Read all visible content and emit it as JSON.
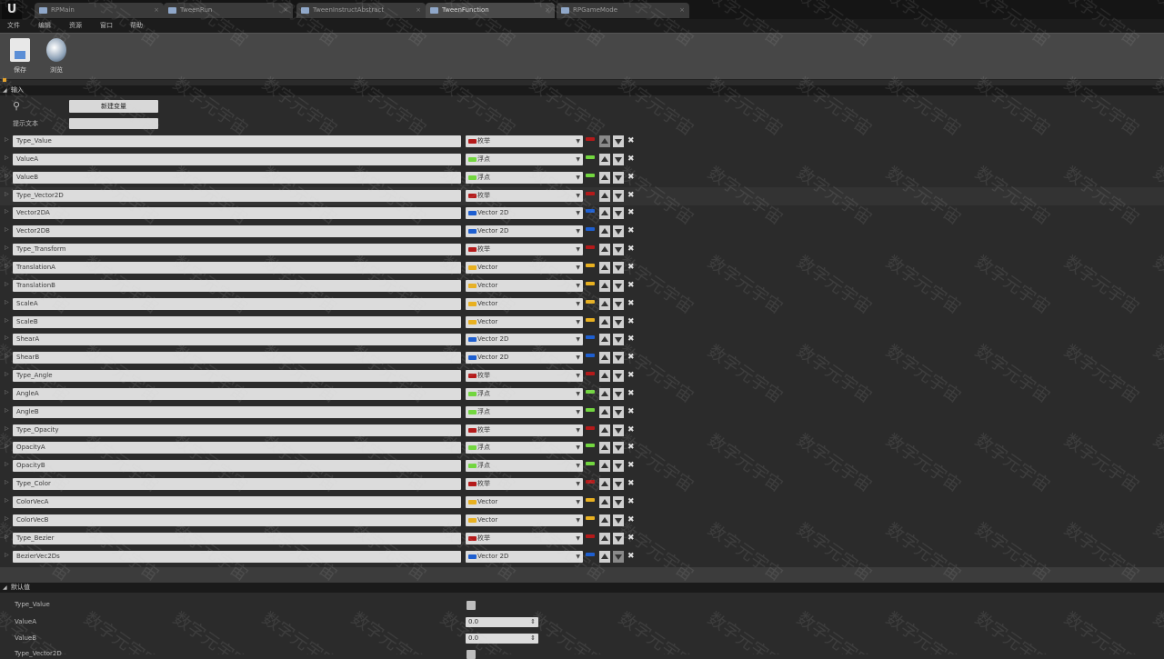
{
  "tabs": [
    {
      "label": "RPMain",
      "active": false
    },
    {
      "label": "TweenRun",
      "active": false
    },
    {
      "label": "TweenInstructAbstract",
      "active": false
    },
    {
      "label": "TweenFunction",
      "active": true
    },
    {
      "label": "RPGameMode",
      "active": false
    }
  ],
  "menu": [
    "文件",
    "编辑",
    "资源",
    "窗口",
    "帮助"
  ],
  "toolbar": {
    "save": "保存",
    "browse": "浏览"
  },
  "sections": {
    "inputs": "输入",
    "defaults": "默认值"
  },
  "vars": {
    "new_var": "新建变量",
    "tooltip_label": "提示文本"
  },
  "rows": [
    {
      "name": "Type_Value",
      "type": "枚举",
      "color": "#b41a1a",
      "up_disabled": true,
      "down_disabled": false
    },
    {
      "name": "ValueA",
      "type": "浮点",
      "color": "#72d63f",
      "up_disabled": false,
      "down_disabled": false
    },
    {
      "name": "ValueB",
      "type": "浮点",
      "color": "#72d63f",
      "up_disabled": false,
      "down_disabled": false
    },
    {
      "name": "Type_Vector2D",
      "type": "枚举",
      "color": "#b41a1a",
      "up_disabled": false,
      "down_disabled": false
    },
    {
      "name": "Vector2DA",
      "type": "Vector 2D",
      "color": "#1e5fd0",
      "up_disabled": false,
      "down_disabled": false
    },
    {
      "name": "Vector2DB",
      "type": "Vector 2D",
      "color": "#1e5fd0",
      "up_disabled": false,
      "down_disabled": false
    },
    {
      "name": "Type_Transform",
      "type": "枚举",
      "color": "#b41a1a",
      "up_disabled": false,
      "down_disabled": false
    },
    {
      "name": "TranslationA",
      "type": "Vector",
      "color": "#e8b020",
      "up_disabled": false,
      "down_disabled": false
    },
    {
      "name": "TranslationB",
      "type": "Vector",
      "color": "#e8b020",
      "up_disabled": false,
      "down_disabled": false
    },
    {
      "name": "ScaleA",
      "type": "Vector",
      "color": "#e8b020",
      "up_disabled": false,
      "down_disabled": false
    },
    {
      "name": "ScaleB",
      "type": "Vector",
      "color": "#e8b020",
      "up_disabled": false,
      "down_disabled": false
    },
    {
      "name": "ShearA",
      "type": "Vector 2D",
      "color": "#1e5fd0",
      "up_disabled": false,
      "down_disabled": false
    },
    {
      "name": "ShearB",
      "type": "Vector 2D",
      "color": "#1e5fd0",
      "up_disabled": false,
      "down_disabled": false
    },
    {
      "name": "Type_Angle",
      "type": "枚举",
      "color": "#b41a1a",
      "up_disabled": false,
      "down_disabled": false
    },
    {
      "name": "AngleA",
      "type": "浮点",
      "color": "#72d63f",
      "up_disabled": false,
      "down_disabled": false
    },
    {
      "name": "AngleB",
      "type": "浮点",
      "color": "#72d63f",
      "up_disabled": false,
      "down_disabled": false
    },
    {
      "name": "Type_Opacity",
      "type": "枚举",
      "color": "#b41a1a",
      "up_disabled": false,
      "down_disabled": false
    },
    {
      "name": "OpacityA",
      "type": "浮点",
      "color": "#72d63f",
      "up_disabled": false,
      "down_disabled": false
    },
    {
      "name": "OpacityB",
      "type": "浮点",
      "color": "#72d63f",
      "up_disabled": false,
      "down_disabled": false
    },
    {
      "name": "Type_Color",
      "type": "枚举",
      "color": "#b41a1a",
      "up_disabled": false,
      "down_disabled": false
    },
    {
      "name": "ColorVecA",
      "type": "Vector",
      "color": "#e8b020",
      "up_disabled": false,
      "down_disabled": false
    },
    {
      "name": "ColorVecB",
      "type": "Vector",
      "color": "#e8b020",
      "up_disabled": false,
      "down_disabled": false
    },
    {
      "name": "Type_Bezier",
      "type": "枚举",
      "color": "#b41a1a",
      "up_disabled": false,
      "down_disabled": false
    },
    {
      "name": "BezierVec2Ds",
      "type": "Vector 2D",
      "color": "#1e5fd0",
      "up_disabled": false,
      "down_disabled": true
    }
  ],
  "highlight_row": 3,
  "defaults": [
    {
      "label": "Type_Value",
      "kind": "check"
    },
    {
      "label": "ValueA",
      "kind": "input",
      "value": "0.0"
    },
    {
      "label": "ValueB",
      "kind": "input",
      "value": "0.0"
    },
    {
      "label": "Type_Vector2D",
      "kind": "check"
    }
  ],
  "watermark": "数字元宇宙"
}
